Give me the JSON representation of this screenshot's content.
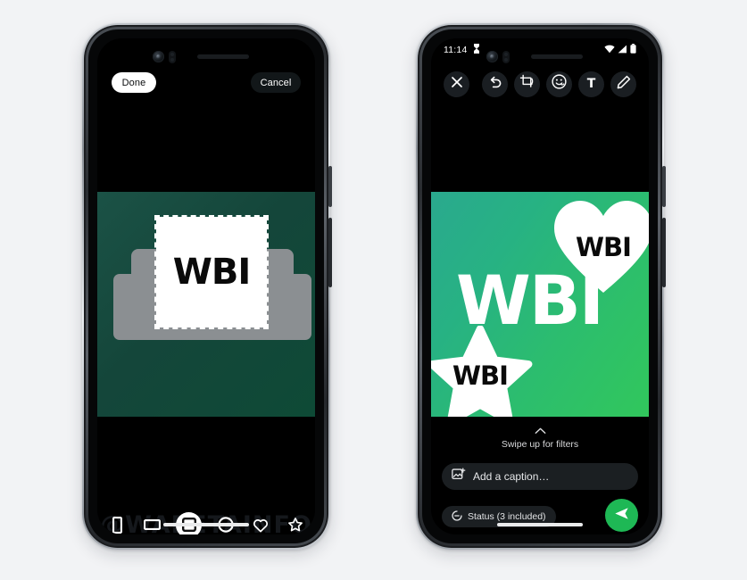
{
  "scene": {
    "background_color": "#f2f3f5",
    "watermark": "@WABetaInfo"
  },
  "phone_left": {
    "name": "sticker-crop-editor",
    "top_bar": {
      "done_label": "Done",
      "cancel_label": "Cancel"
    },
    "canvas": {
      "background_gradient": "#1b5246 -> #0e4a36",
      "selection_label": "WBI",
      "selection_style": "dashed-square-crop"
    },
    "shape_bar": {
      "watermark_text": "@WABETAINFO",
      "shapes": [
        {
          "name": "shape-option-tall-rectangle",
          "icon": "rect-portrait-icon",
          "active": false
        },
        {
          "name": "shape-option-wide-rectangle",
          "icon": "rect-landscape-icon",
          "active": false
        },
        {
          "name": "shape-option-square",
          "icon": "square-icon",
          "active": true
        },
        {
          "name": "shape-option-circle",
          "icon": "circle-icon",
          "active": false
        },
        {
          "name": "shape-option-heart",
          "icon": "heart-icon",
          "active": false
        },
        {
          "name": "shape-option-star",
          "icon": "star-icon",
          "active": false
        }
      ]
    }
  },
  "phone_right": {
    "name": "media-editor",
    "status_bar": {
      "time": "11:14",
      "icons": [
        "alarm-icon",
        "wifi-icon",
        "signal-icon",
        "battery-icon"
      ]
    },
    "toolbar": {
      "close": {
        "label": "",
        "icon": "close-icon"
      },
      "actions": [
        {
          "name": "undo-button",
          "icon": "undo-icon"
        },
        {
          "name": "crop-rotate-button",
          "icon": "crop-rotate-icon"
        },
        {
          "name": "sticker-button",
          "icon": "sticker-emoji-icon"
        },
        {
          "name": "text-button",
          "icon": "text-icon",
          "glyph": "T"
        },
        {
          "name": "draw-button",
          "icon": "pencil-icon"
        }
      ]
    },
    "photo": {
      "background_gradient": "#2aa98e -> #31c75c",
      "main_text": "WBI",
      "stickers": [
        {
          "name": "sticker-heart",
          "shape": "heart",
          "label": "WBI"
        },
        {
          "name": "sticker-star",
          "shape": "star",
          "label": "WBI"
        }
      ]
    },
    "filters": {
      "chevron": "⌃",
      "hint": "Swipe up for filters"
    },
    "caption": {
      "placeholder": "Add a caption…",
      "icon": "add-photo-icon"
    },
    "send_row": {
      "status_chip": "Status (3 included)",
      "status_icon": "status-ring-icon",
      "send_icon": "send-icon",
      "send_color": "#1eb855"
    }
  }
}
